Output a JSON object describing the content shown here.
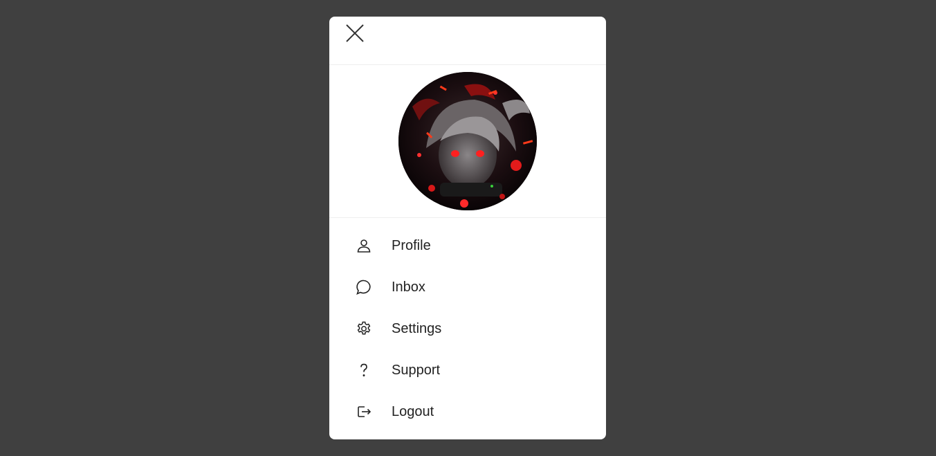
{
  "modal": {
    "close_icon": "close-icon",
    "avatar_icon": "avatar-image"
  },
  "menu": {
    "items": [
      {
        "label": "Profile",
        "icon": "user-icon"
      },
      {
        "label": "Inbox",
        "icon": "chat-bubble-icon"
      },
      {
        "label": "Settings",
        "icon": "gear-icon"
      },
      {
        "label": "Support",
        "icon": "question-icon"
      },
      {
        "label": "Logout",
        "icon": "logout-icon"
      }
    ]
  },
  "colors": {
    "backdrop": "#404040",
    "panel": "#ffffff",
    "text": "#222222",
    "divider": "#eeeeee"
  }
}
